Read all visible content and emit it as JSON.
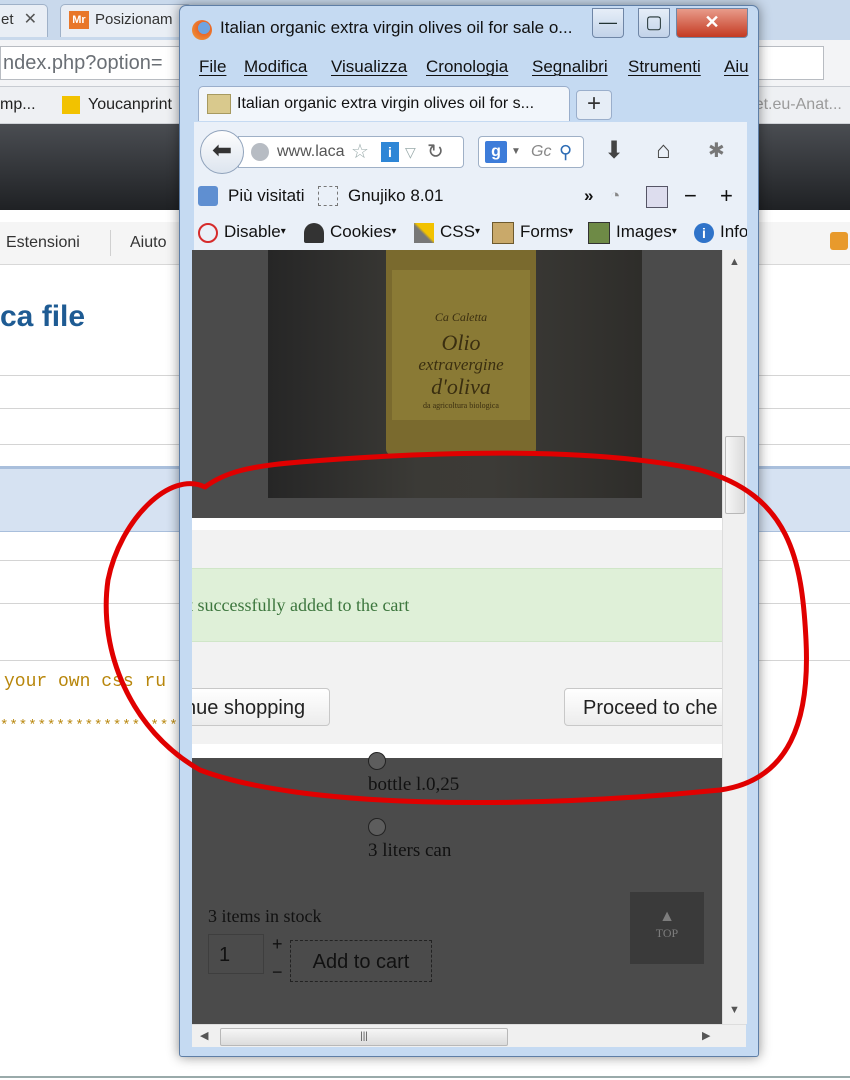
{
  "background": {
    "tabs": [
      {
        "label": "et"
      },
      {
        "label": "Posizionam",
        "icon_text": "Mr"
      }
    ],
    "url": "ndex.php?option=",
    "bookmarks": [
      {
        "label": "mp..."
      },
      {
        "label": "Youcanprint"
      },
      {
        "label": "Chilapiconet.eu-Anat..."
      }
    ],
    "menu": [
      {
        "label": "Estensioni"
      },
      {
        "label": "Aiuto"
      }
    ],
    "page_title": "ca file",
    "code_text": "your own css ru",
    "stars_text": "*************************"
  },
  "window": {
    "title": "Italian organic extra virgin olives oil for sale o...",
    "controls": {
      "minimize": "—",
      "maximize": "▢",
      "close": "✕"
    },
    "menu": [
      "File",
      "Modifica",
      "Visualizza",
      "Cronologia",
      "Segnalibri",
      "Strumenti",
      "Aiu"
    ],
    "tab_label": "Italian organic extra virgin olives oil for s...",
    "new_tab": "+",
    "url": "www.laca",
    "search_placeholder": "Gc",
    "bookmarks": [
      {
        "label": "Più visitati"
      },
      {
        "label": "Gnujiko 8.01"
      }
    ],
    "webdev": [
      {
        "label": "Disable"
      },
      {
        "label": "Cookies"
      },
      {
        "label": "CSS"
      },
      {
        "label": "Forms"
      },
      {
        "label": "Images"
      },
      {
        "label": "Info"
      }
    ]
  },
  "product": {
    "tin_text": {
      "brand": "Ca Caletta",
      "line1": "Olio",
      "line2": "extravergine",
      "line3": "d'oliva",
      "line4": "da agricoltura biologica"
    }
  },
  "modal": {
    "message": "ct successfully added to the cart",
    "continue_label": "nue shopping",
    "proceed_label": "Proceed to che"
  },
  "options": [
    {
      "label": "bottle l.0,25"
    },
    {
      "label": "3 liters can"
    }
  ],
  "stock_text": "3 items in stock",
  "quantity": "1",
  "qty_plus": "+",
  "qty_minus": "−",
  "add_to_cart": "Add to cart",
  "top_label": "TOP",
  "colors": {
    "alert_bg": "#dff0d8",
    "alert_text": "#3c763d",
    "annotation": "#e00000"
  }
}
